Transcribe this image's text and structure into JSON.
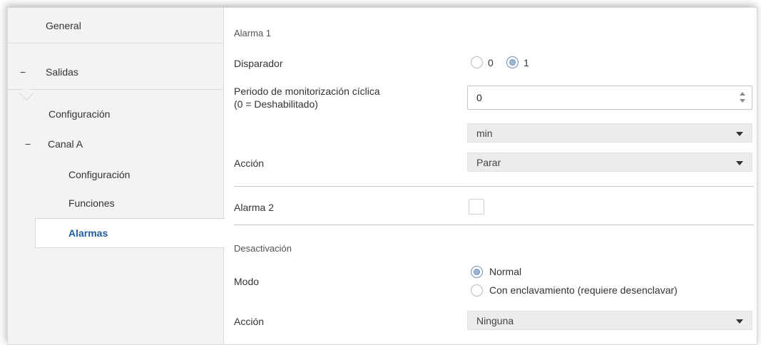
{
  "sidebar": {
    "items": [
      {
        "label": "General"
      },
      {
        "label": "Salidas",
        "prefix": "−"
      },
      {
        "label": "Configuración"
      },
      {
        "label": "Canal A",
        "prefix": "−"
      },
      {
        "label": "Configuración"
      },
      {
        "label": "Funciones"
      },
      {
        "label": "Alarmas"
      }
    ]
  },
  "main": {
    "alarma1": {
      "title": "Alarma 1",
      "disparador": {
        "label": "Disparador",
        "options": [
          "0",
          "1"
        ],
        "selected": "1"
      },
      "periodo": {
        "label_line1": "Periodo de monitorización cíclica",
        "label_line2": "(0 = Deshabilitado)",
        "value": "0"
      },
      "unidad": {
        "value": "min"
      },
      "accion": {
        "label": "Acción",
        "value": "Parar"
      }
    },
    "alarma2": {
      "label": "Alarma 2",
      "checked": false
    },
    "desactivacion": {
      "title": "Desactivación",
      "modo": {
        "label": "Modo",
        "options": [
          "Normal",
          "Con enclavamiento (requiere desenclavar)"
        ],
        "selected": "Normal"
      },
      "accion": {
        "label": "Acción",
        "value": "Ninguna"
      }
    }
  },
  "colors": {
    "accent": "#1f5d9b",
    "radio_fill": "#9fb6d2",
    "sidebar_bg": "#f3f3f3"
  }
}
